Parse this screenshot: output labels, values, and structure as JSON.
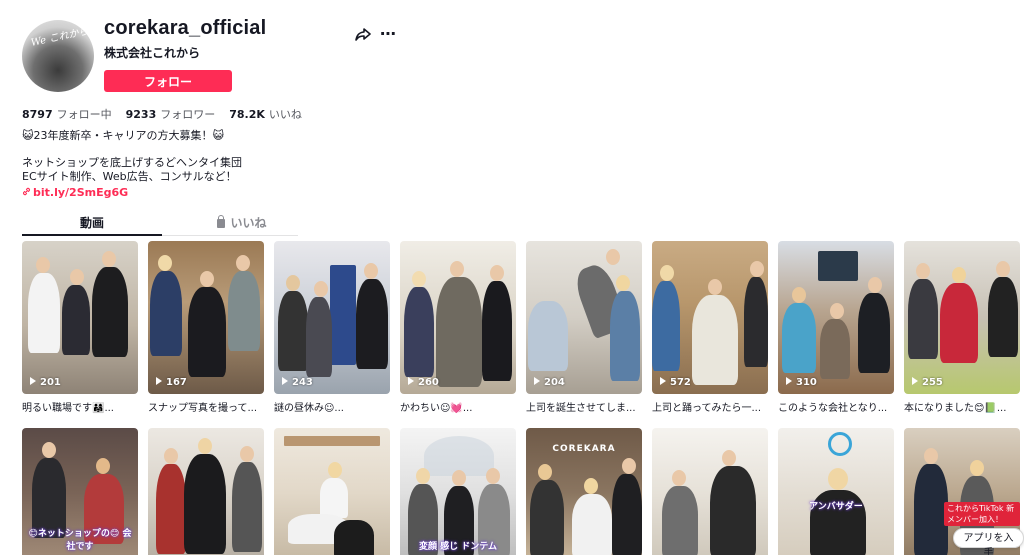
{
  "profile": {
    "username": "corekara_official",
    "nickname": "株式会社これから",
    "avatar_text": "We これから",
    "follow_label": "フォロー"
  },
  "stats": [
    {
      "value": "8797",
      "label": "フォロー中"
    },
    {
      "value": "9233",
      "label": "フォロワー"
    },
    {
      "value": "78.2K",
      "label": "いいね"
    }
  ],
  "bio": {
    "line1": "😺23年度新卒・キャリアの方大募集！😺",
    "line2": "ネットショップを底上げするどヘンタイ集団",
    "line3": "ECサイト制作、Web広告、コンサルなど！",
    "link": "bit.ly/2SmEg6G"
  },
  "tabs": {
    "videos": "動画",
    "likes": "いいね"
  },
  "videos_row1": [
    {
      "views": "201",
      "caption": "明るい職場です👨‍👩‍👧..."
    },
    {
      "views": "167",
      "caption": "スナップ写真を撮って..."
    },
    {
      "views": "243",
      "caption": "謎の昼休み☺..."
    },
    {
      "views": "260",
      "caption": "かわちい☺💓..."
    },
    {
      "views": "204",
      "caption": "上司を誕生させてしま..."
    },
    {
      "views": "572",
      "caption": "上司と踊ってみたら一..."
    },
    {
      "views": "310",
      "caption": "このような会社となり..."
    },
    {
      "views": "255",
      "caption": "本になりました😊📗..."
    }
  ],
  "videos_row2": [
    {
      "overlay": "😊ネットショップの😊 会社です"
    },
    {
      "overlay": ""
    },
    {
      "overlay": ""
    },
    {
      "overlay": "変顔 感じ ドンテム"
    },
    {
      "overlay": "COREKARA"
    },
    {
      "overlay": ""
    },
    {
      "overlay": "アンバサダー"
    },
    {
      "overlay": "これからTikTok 新メンバー加入！"
    }
  ],
  "app_button_label": "アプリを入手",
  "colors": {
    "accent": "#fe2c55",
    "text": "#161823",
    "muted": "#8a8b91"
  },
  "icons": [
    "share-icon",
    "more-icon",
    "link-icon",
    "lock-icon",
    "play-icon"
  ]
}
